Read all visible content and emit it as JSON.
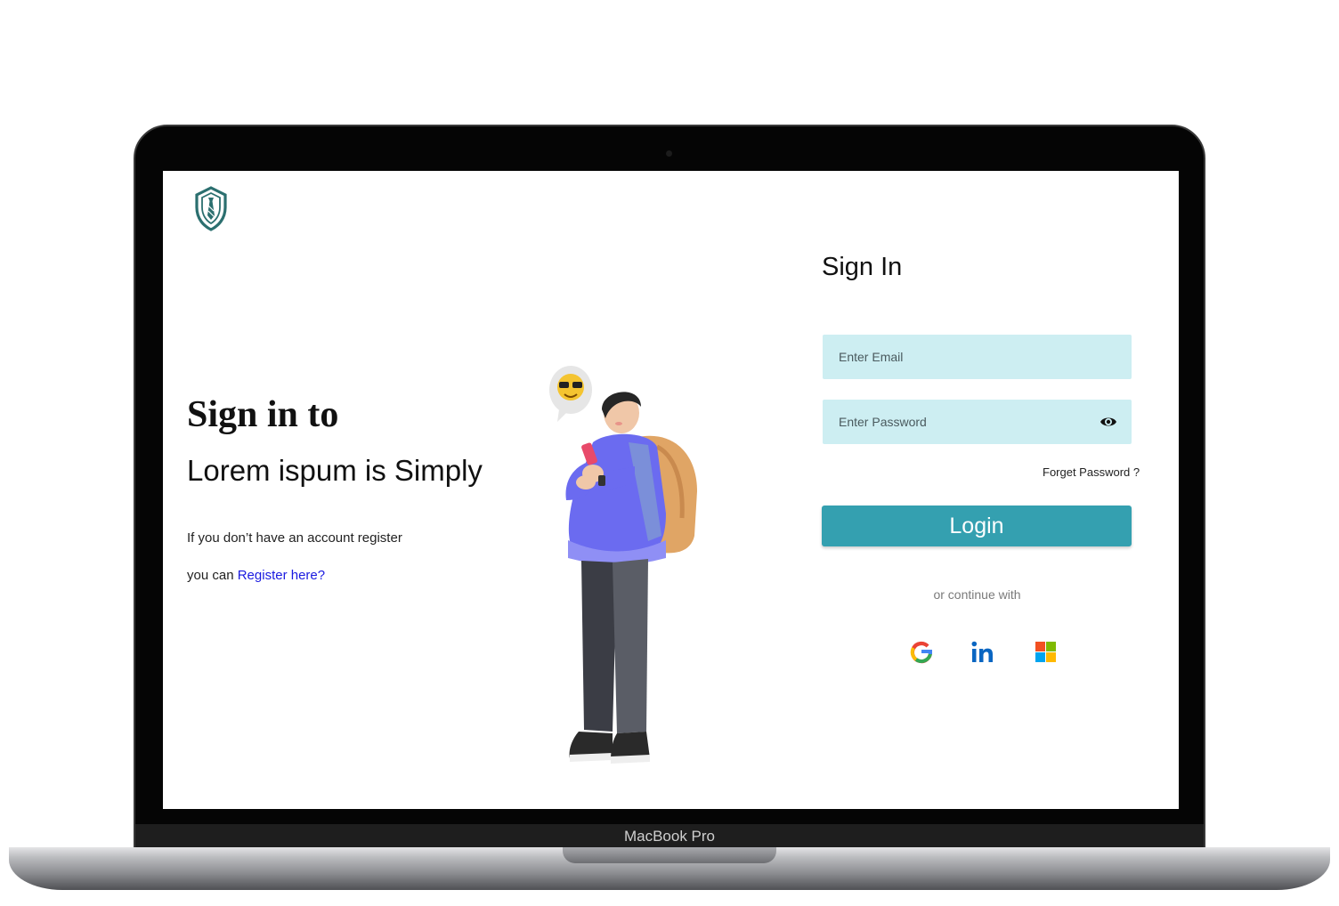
{
  "device": {
    "label": "MacBook Pro"
  },
  "left_panel": {
    "heading": "Sign in to",
    "subheading": "Lorem ispum is Simply",
    "register_line1": "If you don’t have an account register",
    "register_prefix": "you can ",
    "register_link": "Register here?"
  },
  "form": {
    "title": "Sign In",
    "email_placeholder": "Enter Email",
    "password_placeholder": "Enter Password",
    "forgot_label": "Forget Password ?",
    "login_label": "Login",
    "continue_text": "or continue with"
  },
  "social": [
    "google-icon",
    "linkedin-icon",
    "microsoft-icon"
  ],
  "colors": {
    "accent": "#34a0b0",
    "input_bg": "#cdeef2",
    "logo": "#2b6f6f",
    "link": "#1a1ae0"
  },
  "icons": {
    "logo": "shield-tie-icon",
    "password_toggle": "eye-icon"
  }
}
